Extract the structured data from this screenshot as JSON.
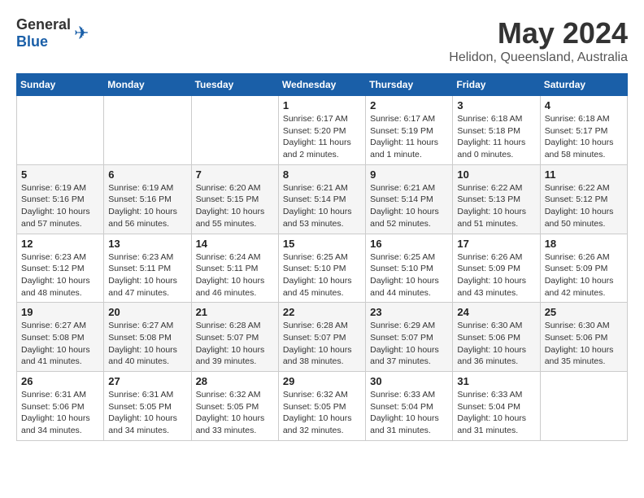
{
  "header": {
    "logo_general": "General",
    "logo_blue": "Blue",
    "month_year": "May 2024",
    "location": "Helidon, Queensland, Australia"
  },
  "weekdays": [
    "Sunday",
    "Monday",
    "Tuesday",
    "Wednesday",
    "Thursday",
    "Friday",
    "Saturday"
  ],
  "weeks": [
    [
      {
        "day": "",
        "sunrise": "",
        "sunset": "",
        "daylight": ""
      },
      {
        "day": "",
        "sunrise": "",
        "sunset": "",
        "daylight": ""
      },
      {
        "day": "",
        "sunrise": "",
        "sunset": "",
        "daylight": ""
      },
      {
        "day": "1",
        "sunrise": "Sunrise: 6:17 AM",
        "sunset": "Sunset: 5:20 PM",
        "daylight": "Daylight: 11 hours and 2 minutes."
      },
      {
        "day": "2",
        "sunrise": "Sunrise: 6:17 AM",
        "sunset": "Sunset: 5:19 PM",
        "daylight": "Daylight: 11 hours and 1 minute."
      },
      {
        "day": "3",
        "sunrise": "Sunrise: 6:18 AM",
        "sunset": "Sunset: 5:18 PM",
        "daylight": "Daylight: 11 hours and 0 minutes."
      },
      {
        "day": "4",
        "sunrise": "Sunrise: 6:18 AM",
        "sunset": "Sunset: 5:17 PM",
        "daylight": "Daylight: 10 hours and 58 minutes."
      }
    ],
    [
      {
        "day": "5",
        "sunrise": "Sunrise: 6:19 AM",
        "sunset": "Sunset: 5:16 PM",
        "daylight": "Daylight: 10 hours and 57 minutes."
      },
      {
        "day": "6",
        "sunrise": "Sunrise: 6:19 AM",
        "sunset": "Sunset: 5:16 PM",
        "daylight": "Daylight: 10 hours and 56 minutes."
      },
      {
        "day": "7",
        "sunrise": "Sunrise: 6:20 AM",
        "sunset": "Sunset: 5:15 PM",
        "daylight": "Daylight: 10 hours and 55 minutes."
      },
      {
        "day": "8",
        "sunrise": "Sunrise: 6:21 AM",
        "sunset": "Sunset: 5:14 PM",
        "daylight": "Daylight: 10 hours and 53 minutes."
      },
      {
        "day": "9",
        "sunrise": "Sunrise: 6:21 AM",
        "sunset": "Sunset: 5:14 PM",
        "daylight": "Daylight: 10 hours and 52 minutes."
      },
      {
        "day": "10",
        "sunrise": "Sunrise: 6:22 AM",
        "sunset": "Sunset: 5:13 PM",
        "daylight": "Daylight: 10 hours and 51 minutes."
      },
      {
        "day": "11",
        "sunrise": "Sunrise: 6:22 AM",
        "sunset": "Sunset: 5:12 PM",
        "daylight": "Daylight: 10 hours and 50 minutes."
      }
    ],
    [
      {
        "day": "12",
        "sunrise": "Sunrise: 6:23 AM",
        "sunset": "Sunset: 5:12 PM",
        "daylight": "Daylight: 10 hours and 48 minutes."
      },
      {
        "day": "13",
        "sunrise": "Sunrise: 6:23 AM",
        "sunset": "Sunset: 5:11 PM",
        "daylight": "Daylight: 10 hours and 47 minutes."
      },
      {
        "day": "14",
        "sunrise": "Sunrise: 6:24 AM",
        "sunset": "Sunset: 5:11 PM",
        "daylight": "Daylight: 10 hours and 46 minutes."
      },
      {
        "day": "15",
        "sunrise": "Sunrise: 6:25 AM",
        "sunset": "Sunset: 5:10 PM",
        "daylight": "Daylight: 10 hours and 45 minutes."
      },
      {
        "day": "16",
        "sunrise": "Sunrise: 6:25 AM",
        "sunset": "Sunset: 5:10 PM",
        "daylight": "Daylight: 10 hours and 44 minutes."
      },
      {
        "day": "17",
        "sunrise": "Sunrise: 6:26 AM",
        "sunset": "Sunset: 5:09 PM",
        "daylight": "Daylight: 10 hours and 43 minutes."
      },
      {
        "day": "18",
        "sunrise": "Sunrise: 6:26 AM",
        "sunset": "Sunset: 5:09 PM",
        "daylight": "Daylight: 10 hours and 42 minutes."
      }
    ],
    [
      {
        "day": "19",
        "sunrise": "Sunrise: 6:27 AM",
        "sunset": "Sunset: 5:08 PM",
        "daylight": "Daylight: 10 hours and 41 minutes."
      },
      {
        "day": "20",
        "sunrise": "Sunrise: 6:27 AM",
        "sunset": "Sunset: 5:08 PM",
        "daylight": "Daylight: 10 hours and 40 minutes."
      },
      {
        "day": "21",
        "sunrise": "Sunrise: 6:28 AM",
        "sunset": "Sunset: 5:07 PM",
        "daylight": "Daylight: 10 hours and 39 minutes."
      },
      {
        "day": "22",
        "sunrise": "Sunrise: 6:28 AM",
        "sunset": "Sunset: 5:07 PM",
        "daylight": "Daylight: 10 hours and 38 minutes."
      },
      {
        "day": "23",
        "sunrise": "Sunrise: 6:29 AM",
        "sunset": "Sunset: 5:07 PM",
        "daylight": "Daylight: 10 hours and 37 minutes."
      },
      {
        "day": "24",
        "sunrise": "Sunrise: 6:30 AM",
        "sunset": "Sunset: 5:06 PM",
        "daylight": "Daylight: 10 hours and 36 minutes."
      },
      {
        "day": "25",
        "sunrise": "Sunrise: 6:30 AM",
        "sunset": "Sunset: 5:06 PM",
        "daylight": "Daylight: 10 hours and 35 minutes."
      }
    ],
    [
      {
        "day": "26",
        "sunrise": "Sunrise: 6:31 AM",
        "sunset": "Sunset: 5:06 PM",
        "daylight": "Daylight: 10 hours and 34 minutes."
      },
      {
        "day": "27",
        "sunrise": "Sunrise: 6:31 AM",
        "sunset": "Sunset: 5:05 PM",
        "daylight": "Daylight: 10 hours and 34 minutes."
      },
      {
        "day": "28",
        "sunrise": "Sunrise: 6:32 AM",
        "sunset": "Sunset: 5:05 PM",
        "daylight": "Daylight: 10 hours and 33 minutes."
      },
      {
        "day": "29",
        "sunrise": "Sunrise: 6:32 AM",
        "sunset": "Sunset: 5:05 PM",
        "daylight": "Daylight: 10 hours and 32 minutes."
      },
      {
        "day": "30",
        "sunrise": "Sunrise: 6:33 AM",
        "sunset": "Sunset: 5:04 PM",
        "daylight": "Daylight: 10 hours and 31 minutes."
      },
      {
        "day": "31",
        "sunrise": "Sunrise: 6:33 AM",
        "sunset": "Sunset: 5:04 PM",
        "daylight": "Daylight: 10 hours and 31 minutes."
      },
      {
        "day": "",
        "sunrise": "",
        "sunset": "",
        "daylight": ""
      }
    ]
  ]
}
